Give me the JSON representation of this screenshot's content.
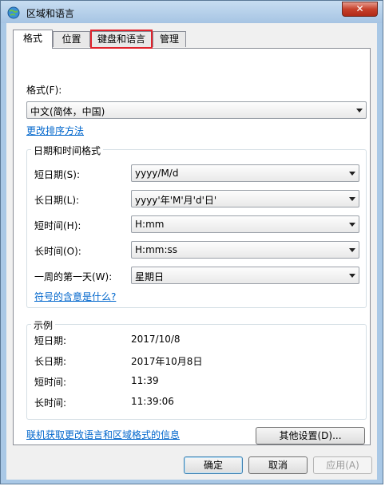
{
  "window": {
    "title": "区域和语言",
    "close_symbol": "✕"
  },
  "tabs": [
    {
      "label": "格式"
    },
    {
      "label": "位置"
    },
    {
      "label": "键盘和语言"
    },
    {
      "label": "管理"
    }
  ],
  "format": {
    "label": "格式(F):",
    "value": "中文(简体，中国)",
    "change_sort_link": "更改排序方法"
  },
  "date_time_group": {
    "title": "日期和时间格式",
    "rows": [
      {
        "label": "短日期(S):",
        "value": "yyyy/M/d"
      },
      {
        "label": "长日期(L):",
        "value": "yyyy'年'M'月'd'日'"
      },
      {
        "label": "短时间(H):",
        "value": "H:mm"
      },
      {
        "label": "长时间(O):",
        "value": "H:mm:ss"
      },
      {
        "label": "一周的第一天(W):",
        "value": "星期日"
      }
    ],
    "symbols_link": "符号的含意是什么?"
  },
  "example_group": {
    "title": "示例",
    "rows": [
      {
        "label": "短日期:",
        "value": "2017/10/8"
      },
      {
        "label": "长日期:",
        "value": "2017年10月8日"
      },
      {
        "label": "短时间:",
        "value": "11:39"
      },
      {
        "label": "长时间:",
        "value": "11:39:06"
      }
    ]
  },
  "additional_settings_button": "其他设置(D)...",
  "online_info_link": "联机获取更改语言和区域格式的信息",
  "footer": {
    "ok": "确定",
    "cancel": "取消",
    "apply": "应用(A)"
  },
  "colors": {
    "highlight_box": "#e0232c",
    "link": "#0066cc"
  },
  "icons": {
    "app": "globe-icon",
    "dropdown": "chevron-down-icon",
    "close": "close-icon"
  }
}
